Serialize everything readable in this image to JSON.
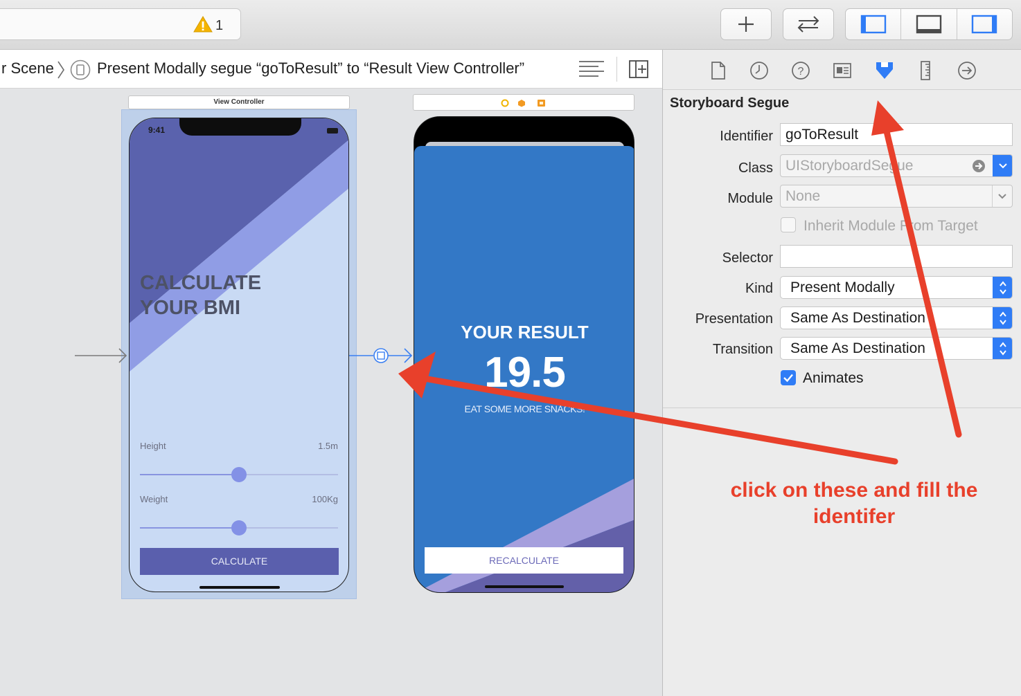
{
  "toolbar": {
    "warning_count": "1"
  },
  "jumpbar": {
    "scene_crumb": "r Scene",
    "segue_crumb": "Present Modally segue “goToResult” to “Result View Controller”"
  },
  "canvas": {
    "view_controller_title": "View Controller",
    "vc1": {
      "time": "9:41",
      "headline_line1": "CALCULATE",
      "headline_line2": "YOUR BMI",
      "height_label": "Height",
      "height_value": "1.5m",
      "height_slider_fraction": 0.5,
      "weight_label": "Weight",
      "weight_value": "100Kg",
      "weight_slider_fraction": 0.5,
      "button_label": "CALCULATE"
    },
    "vc2": {
      "result_title": "YOUR RESULT",
      "result_value": "19.5",
      "advice": "EAT SOME MORE SNACKS!",
      "button_label": "RECALCULATE"
    }
  },
  "inspector": {
    "section_title": "Storyboard Segue",
    "identifier_label": "Identifier",
    "identifier_value": "goToResult",
    "class_label": "Class",
    "class_placeholder": "UIStoryboardSegue",
    "module_label": "Module",
    "module_placeholder": "None",
    "inherit_label": "Inherit Module From Target",
    "selector_label": "Selector",
    "selector_value": "",
    "kind_label": "Kind",
    "kind_value": "Present Modally",
    "presentation_label": "Presentation",
    "presentation_value": "Same As Destination",
    "transition_label": "Transition",
    "transition_value": "Same As Destination",
    "animates_label": "Animates"
  },
  "annotation": {
    "text": "click on these and fill the identifer",
    "color": "#e8402b"
  },
  "colors": {
    "accent": "#2f7cf6",
    "vc1_background": "#c9daf4",
    "vc1_stripe_dark": "#5862ad",
    "vc1_stripe_light": "#8a98e6",
    "vc2_background": "#3378c6",
    "button_dark": "#5a5fad"
  }
}
